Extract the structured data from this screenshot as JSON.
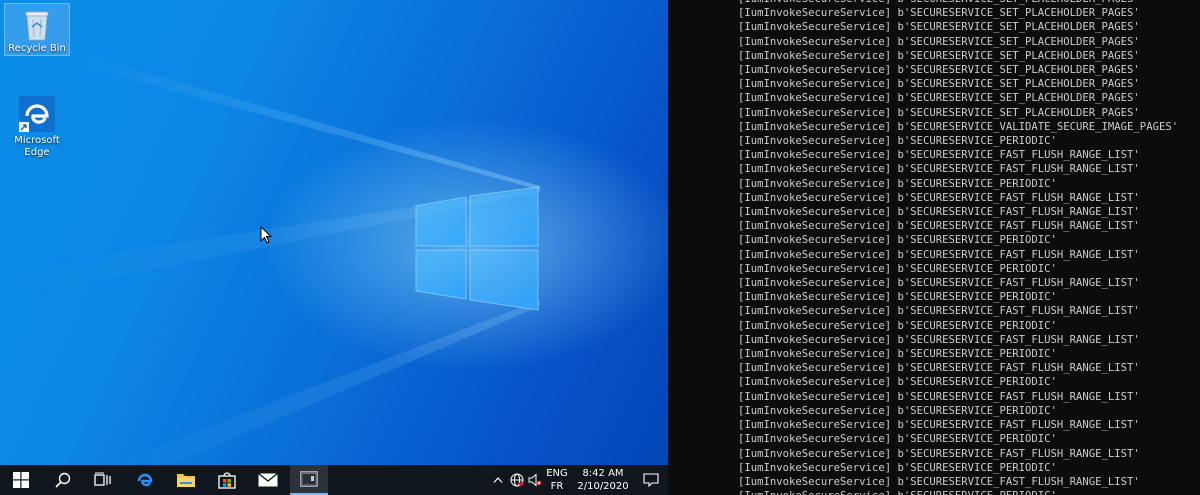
{
  "desktop": {
    "icons": [
      {
        "label": "Recycle Bin",
        "icon": "recycle-bin-icon"
      },
      {
        "label": "Microsoft\nEdge",
        "icon": "edge-icon"
      }
    ]
  },
  "taskbar": {
    "buttons": [
      {
        "icon": "windows-start-icon"
      },
      {
        "icon": "search-icon"
      },
      {
        "icon": "task-view-icon"
      },
      {
        "icon": "edge-icon"
      },
      {
        "icon": "file-explorer-icon"
      },
      {
        "icon": "store-icon"
      },
      {
        "icon": "mail-icon"
      },
      {
        "icon": "console-app-icon"
      }
    ],
    "tray": {
      "lang_top": "ENG",
      "lang_bottom": "FR",
      "time": "8:42 AM",
      "date": "2/10/2020"
    }
  },
  "console": {
    "lines": [
      "[IumInvokeSecureService] b'SECURESERVICE_SET_PLACEHOLDER_PAGES'",
      "[IumInvokeSecureService] b'SECURESERVICE_SET_PLACEHOLDER_PAGES'",
      "[IumInvokeSecureService] b'SECURESERVICE_SET_PLACEHOLDER_PAGES'",
      "[IumInvokeSecureService] b'SECURESERVICE_SET_PLACEHOLDER_PAGES'",
      "[IumInvokeSecureService] b'SECURESERVICE_SET_PLACEHOLDER_PAGES'",
      "[IumInvokeSecureService] b'SECURESERVICE_SET_PLACEHOLDER_PAGES'",
      "[IumInvokeSecureService] b'SECURESERVICE_SET_PLACEHOLDER_PAGES'",
      "[IumInvokeSecureService] b'SECURESERVICE_SET_PLACEHOLDER_PAGES'",
      "[IumInvokeSecureService] b'SECURESERVICE_SET_PLACEHOLDER_PAGES'",
      "[IumInvokeSecureService] b'SECURESERVICE_VALIDATE_SECURE_IMAGE_PAGES'",
      "[IumInvokeSecureService] b'SECURESERVICE_PERIODIC'",
      "[IumInvokeSecureService] b'SECURESERVICE_FAST_FLUSH_RANGE_LIST'",
      "[IumInvokeSecureService] b'SECURESERVICE_FAST_FLUSH_RANGE_LIST'",
      "[IumInvokeSecureService] b'SECURESERVICE_PERIODIC'",
      "[IumInvokeSecureService] b'SECURESERVICE_FAST_FLUSH_RANGE_LIST'",
      "[IumInvokeSecureService] b'SECURESERVICE_FAST_FLUSH_RANGE_LIST'",
      "[IumInvokeSecureService] b'SECURESERVICE_FAST_FLUSH_RANGE_LIST'",
      "[IumInvokeSecureService] b'SECURESERVICE_PERIODIC'",
      "[IumInvokeSecureService] b'SECURESERVICE_FAST_FLUSH_RANGE_LIST'",
      "[IumInvokeSecureService] b'SECURESERVICE_PERIODIC'",
      "[IumInvokeSecureService] b'SECURESERVICE_FAST_FLUSH_RANGE_LIST'",
      "[IumInvokeSecureService] b'SECURESERVICE_PERIODIC'",
      "[IumInvokeSecureService] b'SECURESERVICE_FAST_FLUSH_RANGE_LIST'",
      "[IumInvokeSecureService] b'SECURESERVICE_PERIODIC'",
      "[IumInvokeSecureService] b'SECURESERVICE_FAST_FLUSH_RANGE_LIST'",
      "[IumInvokeSecureService] b'SECURESERVICE_PERIODIC'",
      "[IumInvokeSecureService] b'SECURESERVICE_FAST_FLUSH_RANGE_LIST'",
      "[IumInvokeSecureService] b'SECURESERVICE_PERIODIC'",
      "[IumInvokeSecureService] b'SECURESERVICE_FAST_FLUSH_RANGE_LIST'",
      "[IumInvokeSecureService] b'SECURESERVICE_PERIODIC'",
      "[IumInvokeSecureService] b'SECURESERVICE_FAST_FLUSH_RANGE_LIST'",
      "[IumInvokeSecureService] b'SECURESERVICE_PERIODIC'",
      "[IumInvokeSecureService] b'SECURESERVICE_FAST_FLUSH_RANGE_LIST'",
      "[IumInvokeSecureService] b'SECURESERVICE_PERIODIC'",
      "[IumInvokeSecureService] b'SECURESERVICE_FAST_FLUSH_RANGE_LIST'",
      "[IumInvokeSecureService] b'SECURESERVICE_PERIODIC'"
    ]
  }
}
